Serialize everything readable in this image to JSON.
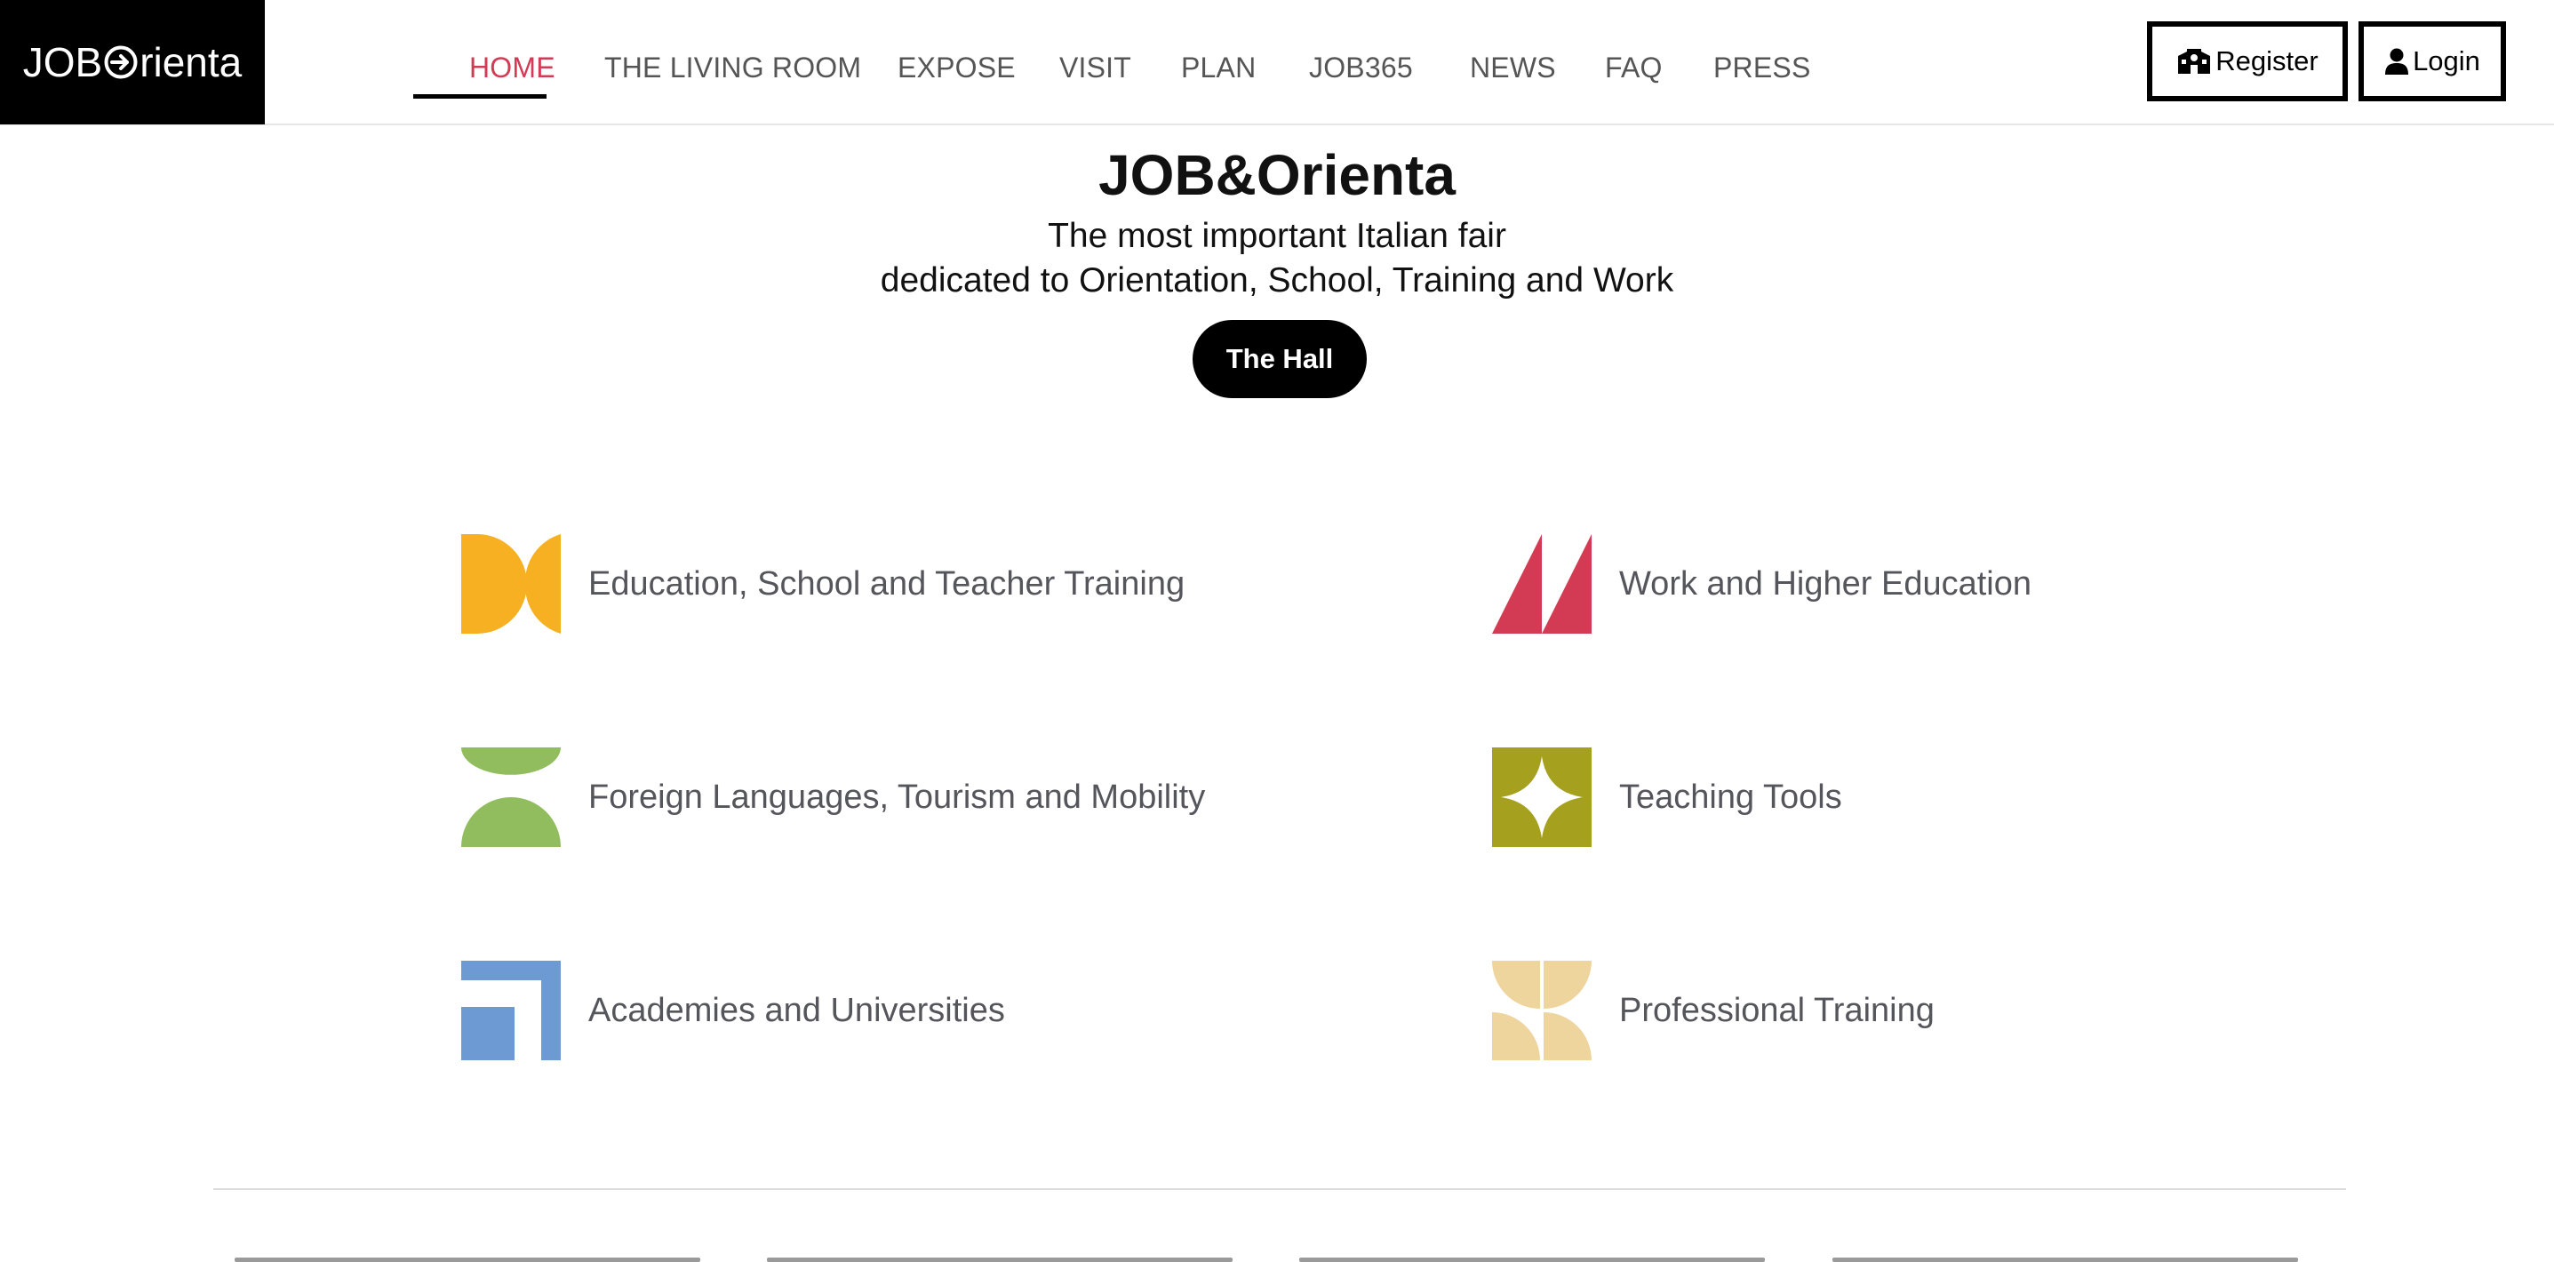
{
  "brand": {
    "logo_text_before": "JOB",
    "logo_text_after": "rienta"
  },
  "nav": {
    "items": [
      {
        "label": "HOME",
        "active": true
      },
      {
        "label": "THE LIVING ROOM"
      },
      {
        "label": "EXPOSE"
      },
      {
        "label": "VISIT"
      },
      {
        "label": "PLAN"
      },
      {
        "label": "JOB365"
      },
      {
        "label": "NEWS"
      },
      {
        "label": "FAQ"
      },
      {
        "label": "PRESS"
      }
    ],
    "active_color": "#d33b55"
  },
  "header_actions": {
    "register_label": "Register",
    "register_icon": "school-building-icon",
    "login_label": "Login",
    "login_icon": "user-icon"
  },
  "hero": {
    "title": "JOB&Orienta",
    "subtitle_line1": "The most important Italian fair",
    "subtitle_line2": "dedicated to Orientation, School, Training and Work",
    "cta_label": "The Hall"
  },
  "categories": [
    {
      "label": "Education, School and Teacher Training",
      "icon": "yellow-arcs-icon",
      "color": "#f6b021"
    },
    {
      "label": "Work and Higher Education",
      "icon": "red-triangles-icon",
      "color": "#d33b55"
    },
    {
      "label": "Foreign Languages, Tourism and Mobility",
      "icon": "green-half-circles-icon",
      "color": "#92bd5e"
    },
    {
      "label": "Teaching Tools",
      "icon": "olive-star-icon",
      "color": "#a5a11e"
    },
    {
      "label": "Academies and Universities",
      "icon": "blue-square-icon",
      "color": "#6e9ad4"
    },
    {
      "label": "Professional Training",
      "icon": "beige-petals-icon",
      "color": "#eed59e"
    }
  ]
}
